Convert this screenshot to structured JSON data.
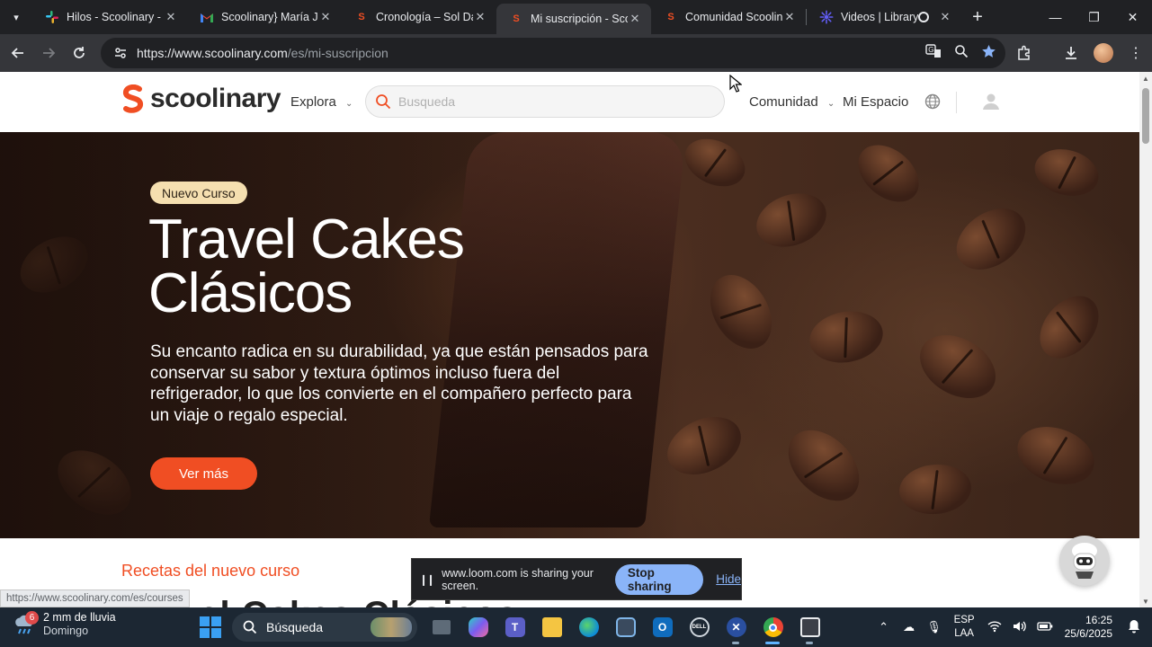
{
  "browser": {
    "tabs": [
      {
        "title": "Hilos - Scoolinary - Sl",
        "favicon": "slack-icon"
      },
      {
        "title": "Scoolinary} María Jes",
        "favicon": "gmail-icon"
      },
      {
        "title": "Cronología – Sol Dan",
        "favicon": "scoolinary-icon"
      },
      {
        "title": "Mi suscripción - Scoo",
        "favicon": "scoolinary-icon",
        "active": true
      },
      {
        "title": "Comunidad Scoolinar",
        "favicon": "scoolinary-icon"
      },
      {
        "title": "Videos | Library | L",
        "favicon": "loom-icon"
      }
    ],
    "url_host": "https://www.scoolinary.com",
    "url_path": "/es/mi-suscripcion"
  },
  "site": {
    "logo_text": "scoolinary",
    "nav_explore": "Explora",
    "search_placeholder": "Busqueda",
    "nav_comunidad": "Comunidad",
    "nav_espacio": "Mi Espacio"
  },
  "hero": {
    "badge": "Nuevo Curso",
    "title_line1": "Travel Cakes",
    "title_line2": "Clásicos",
    "description": "Su encanto radica en su durabilidad, ya que están pensados para conservar su sabor y textura óptimos incluso fuera del refrigerador, lo que los convierte en el compañero perfecto para un viaje o regalo especial.",
    "cta": "Ver más"
  },
  "section": {
    "label": "Recetas del nuevo curso",
    "partial_heading": "Travel Cakes Clásicos"
  },
  "loom_bar": {
    "message": "www.loom.com is sharing your screen.",
    "stop_label": "Stop sharing",
    "hide_label": "Hide"
  },
  "status_url": "https://www.scoolinary.com/es/courses",
  "taskbar": {
    "weather_badge": "6",
    "weather_line1": "2 mm de lluvia",
    "weather_line2": "Domingo",
    "search_label": "Búsqueda",
    "lang_line1": "ESP",
    "lang_line2": "LAA",
    "time": "16:25",
    "date": "25/6/2025"
  },
  "colors": {
    "brand_orange": "#f04e23",
    "badge_bg": "#f5dfb0",
    "browser_dark": "#202124",
    "loom_stop": "#8ab4f8"
  }
}
